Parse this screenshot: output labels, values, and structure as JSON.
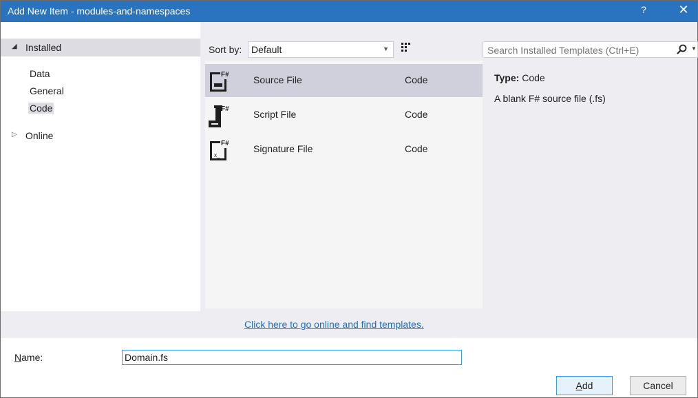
{
  "window": {
    "title": "Add New Item - modules-and-namespaces",
    "help_label": "?",
    "close_label": "✕"
  },
  "tree": {
    "installed_label": "Installed",
    "items": [
      "Data",
      "General",
      "Code"
    ],
    "selected_item": "Code",
    "online_label": "Online"
  },
  "toolbar": {
    "sort_label": "Sort by:",
    "sort_value": "Default",
    "view_modes": [
      "medium-icons",
      "list"
    ],
    "active_view": "list"
  },
  "search": {
    "placeholder": "Search Installed Templates (Ctrl+E)"
  },
  "templates": [
    {
      "name": "Source File",
      "category": "Code",
      "icon": "fsharp-source-file-icon"
    },
    {
      "name": "Script File",
      "category": "Code",
      "icon": "fsharp-script-file-icon"
    },
    {
      "name": "Signature File",
      "category": "Code",
      "icon": "fsharp-signature-file-icon"
    }
  ],
  "selected_template": "Source File",
  "details": {
    "type_label": "Type:",
    "type_value": "Code",
    "description": "A blank F# source file (.fs)"
  },
  "online_link": "Click here to go online and find templates.",
  "form": {
    "name_label_prefix": "N",
    "name_label_rest": "ame:",
    "name_value": "Domain.fs"
  },
  "buttons": {
    "add_prefix": "A",
    "add_rest": "dd",
    "cancel": "Cancel"
  },
  "colors": {
    "titlebar": "#2a73bf",
    "selection": "#cfd0dc",
    "focus_border": "#3399ff",
    "link": "#1a6fc7"
  }
}
